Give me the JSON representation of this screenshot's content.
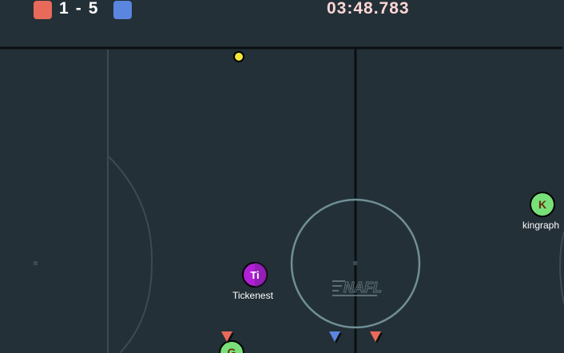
{
  "hud": {
    "red_score": "1",
    "separator": "-",
    "blue_score": "5",
    "timer": "03:48.783",
    "red_color": "#e86a5a",
    "blue_color": "#5a86e0"
  },
  "field": {
    "background": "#243037",
    "line_color": "#0a0f12",
    "faint_line_color": "#3c4a52",
    "center_circle_color": "#6f8f96",
    "logo_text": "NAFL"
  },
  "players": [
    {
      "initials": "Ti",
      "name": "Tickenest",
      "color": "#b21fd6"
    },
    {
      "initials": "K",
      "name": "kingraph",
      "color": "#78e078"
    },
    {
      "initials": "G",
      "name": "",
      "color": "#78e078"
    }
  ],
  "ball": {
    "color": "#f5e63a"
  },
  "markers": [
    {
      "team": "red",
      "color": "#e86a5a"
    },
    {
      "team": "blue",
      "color": "#5a86e0"
    },
    {
      "team": "red",
      "color": "#e86a5a"
    }
  ]
}
